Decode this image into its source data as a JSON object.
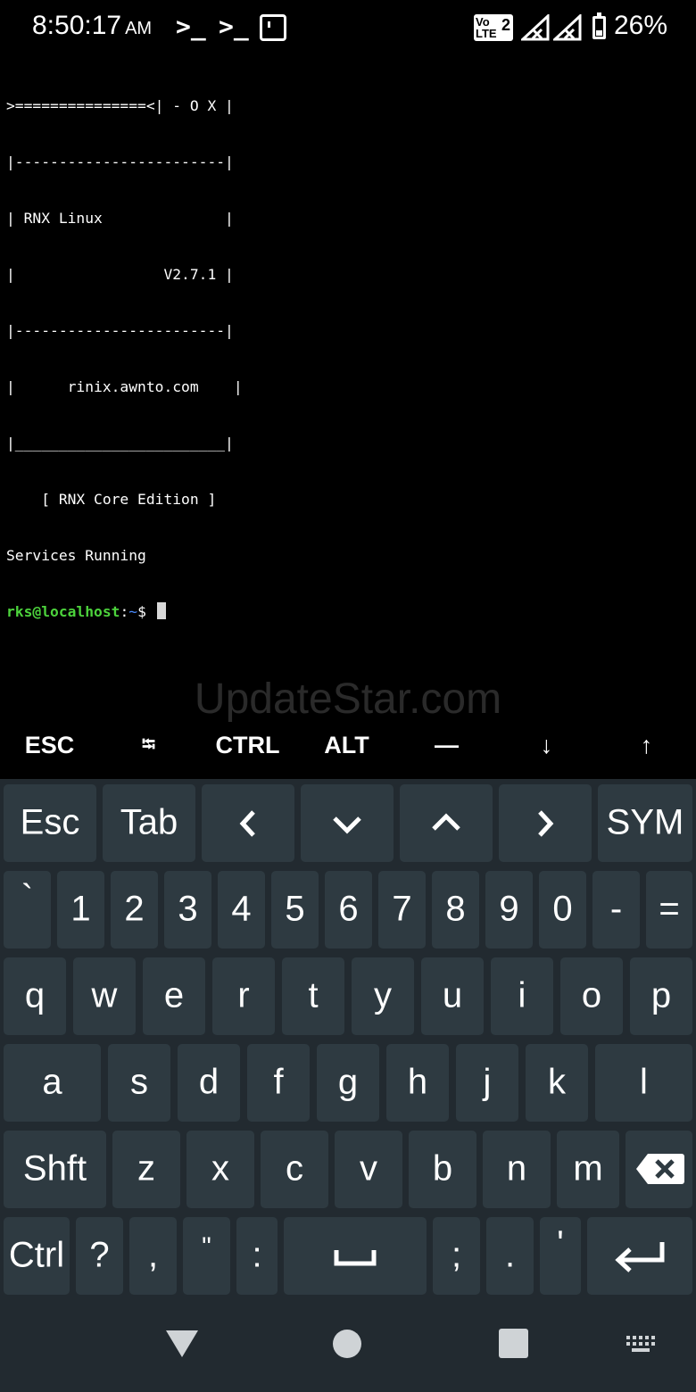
{
  "status_bar": {
    "time": "8:50:17",
    "ampm": "AM",
    "notification_icons": [
      "terminal-prompt-icon",
      "terminal-prompt-icon",
      "terminal-window-icon"
    ],
    "network": "Vo LTE",
    "sim_slot": "2",
    "battery": "26%"
  },
  "terminal": {
    "lines": [
      ">===============<| - O X |",
      "|------------------------|",
      "| RNX Linux              |",
      "|                 V2.7.1 |",
      "|------------------------|",
      "|      rinix.awnto.com    |",
      "|________________________|",
      "    [ RNX Core Edition ]",
      "Services Running"
    ],
    "prompt_user": "rks@localhost",
    "prompt_sep": ":",
    "prompt_path": "~",
    "prompt_symbol": "$ "
  },
  "watermark": "UpdateStar.com",
  "extra_keys": [
    "ESC",
    "⭾",
    "CTRL",
    "ALT",
    "—",
    "↓",
    "↑"
  ],
  "keyboard": {
    "row1": [
      "Esc",
      "Tab",
      "‹",
      "⌄",
      "⌃",
      "›",
      "SYM"
    ],
    "row2": [
      "`",
      "1",
      "2",
      "3",
      "4",
      "5",
      "6",
      "7",
      "8",
      "9",
      "0",
      "-",
      "="
    ],
    "row3": [
      "q",
      "w",
      "e",
      "r",
      "t",
      "y",
      "u",
      "i",
      "o",
      "p"
    ],
    "row4": [
      "a",
      "s",
      "d",
      "f",
      "g",
      "h",
      "j",
      "k",
      "l"
    ],
    "row5": [
      "Shft",
      "z",
      "x",
      "c",
      "v",
      "b",
      "n",
      "m",
      "⌫"
    ],
    "row6": [
      "Ctrl",
      "?",
      ",",
      "\"",
      ":",
      "␣",
      ";",
      ".",
      "'",
      "↵"
    ]
  },
  "colors": {
    "background": "#000000",
    "keyboard_bg": "#222a30",
    "key_bg": "#2e3a41",
    "prompt_user": "#4cd23c",
    "prompt_path": "#4a8cff"
  }
}
